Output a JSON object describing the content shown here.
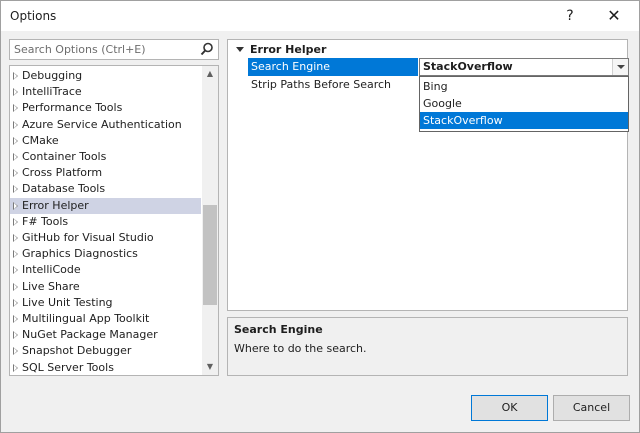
{
  "window": {
    "title": "Options",
    "help_glyph": "?",
    "close_glyph": "✕"
  },
  "search": {
    "placeholder": "Search Options (Ctrl+E)",
    "icon": "search-icon"
  },
  "tree": {
    "items": [
      {
        "label": "Debugging"
      },
      {
        "label": "IntelliTrace"
      },
      {
        "label": "Performance Tools"
      },
      {
        "label": "Azure Service Authentication"
      },
      {
        "label": "CMake"
      },
      {
        "label": "Container Tools"
      },
      {
        "label": "Cross Platform"
      },
      {
        "label": "Database Tools"
      },
      {
        "label": "Error Helper",
        "selected": true
      },
      {
        "label": "F# Tools"
      },
      {
        "label": "GitHub for Visual Studio"
      },
      {
        "label": "Graphics Diagnostics"
      },
      {
        "label": "IntelliCode"
      },
      {
        "label": "Live Share"
      },
      {
        "label": "Live Unit Testing"
      },
      {
        "label": "Multilingual App Toolkit"
      },
      {
        "label": "NuGet Package Manager"
      },
      {
        "label": "Snapshot Debugger"
      },
      {
        "label": "SQL Server Tools"
      }
    ]
  },
  "properties": {
    "category": "Error Helper",
    "rows": [
      {
        "name": "Search Engine",
        "value": "StackOverflow"
      },
      {
        "name": "Strip Paths Before Search",
        "value": ""
      }
    ],
    "dropdown_options": [
      {
        "label": "Bing"
      },
      {
        "label": "Google"
      },
      {
        "label": "StackOverflow",
        "selected": true
      }
    ]
  },
  "description": {
    "title": "Search Engine",
    "text": "Where to do the search."
  },
  "buttons": {
    "ok": "OK",
    "cancel": "Cancel"
  },
  "colors": {
    "selection_blue": "#0078d7",
    "tree_selection": "#cfd3e4"
  }
}
